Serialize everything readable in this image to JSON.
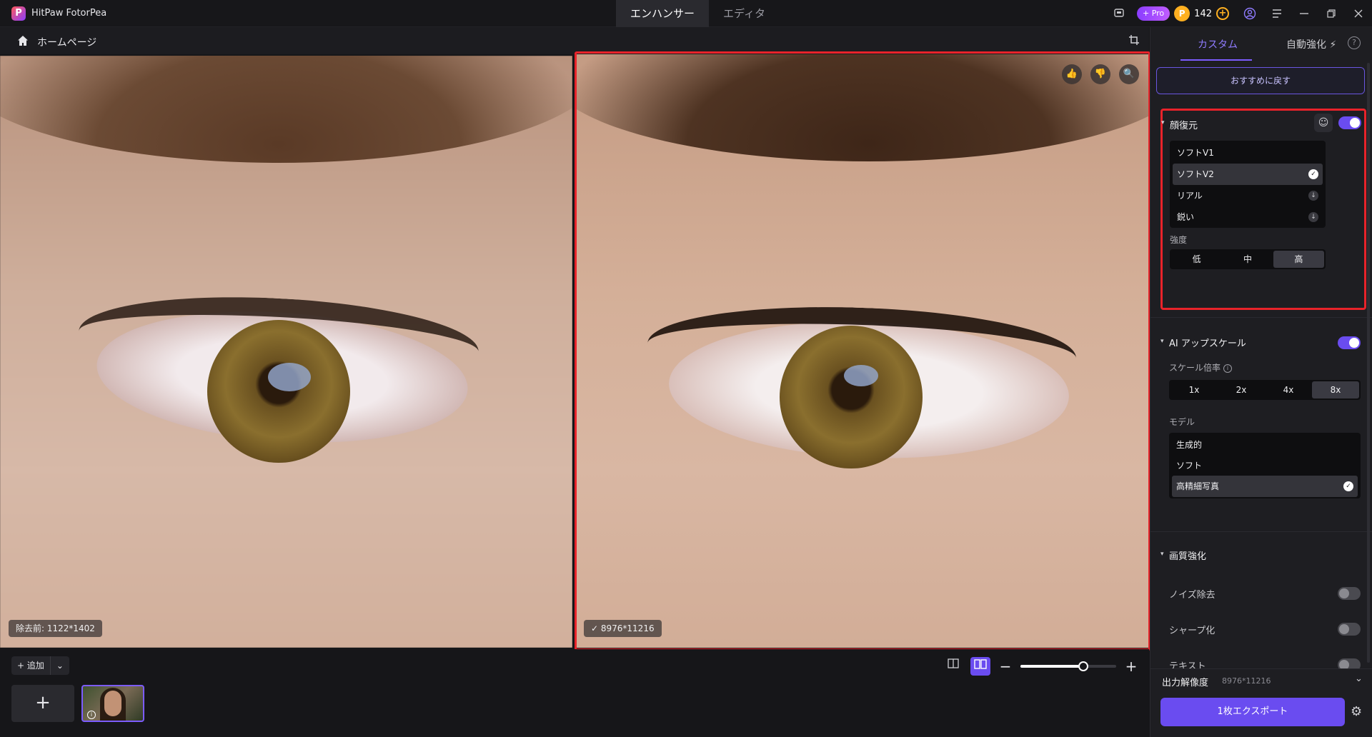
{
  "app": {
    "title": "HitPaw FotorPea",
    "logo_letter": "P"
  },
  "mode_tabs": [
    {
      "label": "エンハンサー",
      "active": true
    },
    {
      "label": "エディタ",
      "active": false
    }
  ],
  "titlebar": {
    "pro_label": "+ Pro",
    "coin_symbol": "P",
    "coins": "142",
    "coin_add": "+"
  },
  "subbar": {
    "home_label": "ホームページ"
  },
  "preview": {
    "before_label": "除去前: 1122*1402",
    "after_label": "✓ 8976*11216",
    "tools": {
      "like": "👍",
      "dislike": "👎",
      "zoom": "🔍"
    }
  },
  "bottom": {
    "add_label": "+ 追加",
    "add_caret": "⌄",
    "thumb_add": "+",
    "zoom_minus": "−",
    "zoom_plus": "+",
    "zoom_level": 0.66
  },
  "panel": {
    "tabs": [
      {
        "label": "カスタム",
        "active": true
      },
      {
        "label": "自動強化 ⚡",
        "active": false
      }
    ],
    "help": "?",
    "reset_label": "おすすめに戻す",
    "face": {
      "title": "顔復元",
      "enabled": true,
      "options": [
        {
          "label": "ソフトV1",
          "state": "none"
        },
        {
          "label": "ソフトV2",
          "state": "selected"
        },
        {
          "label": "リアル",
          "state": "download"
        },
        {
          "label": "鋭い",
          "state": "download"
        }
      ],
      "strength_label": "強度",
      "strength": [
        {
          "label": "低"
        },
        {
          "label": "中"
        },
        {
          "label": "高",
          "active": true
        }
      ]
    },
    "upscale": {
      "title": "AI アップスケール",
      "enabled": true,
      "scale_label": "スケール倍率",
      "scales": [
        {
          "label": "1x"
        },
        {
          "label": "2x"
        },
        {
          "label": "4x"
        },
        {
          "label": "8x",
          "active": true
        }
      ],
      "model_label": "モデル",
      "models": [
        {
          "label": "生成的",
          "state": "none"
        },
        {
          "label": "ソフト",
          "state": "none"
        },
        {
          "label": "高精細写真",
          "state": "selected"
        }
      ]
    },
    "quality": {
      "title": "画質強化",
      "items": [
        {
          "label": "ノイズ除去",
          "enabled": false
        },
        {
          "label": "シャープ化",
          "enabled": false
        },
        {
          "label": "テキスト",
          "enabled": false
        }
      ]
    },
    "output": {
      "label": "出力解像度",
      "value": "8976*11216",
      "caret": "⌄",
      "export_label": "1枚エクスポート",
      "gear": "⚙"
    }
  },
  "colors": {
    "accent": "#6a4cf0",
    "highlight_border": "#e8232a",
    "background": "#161619"
  }
}
